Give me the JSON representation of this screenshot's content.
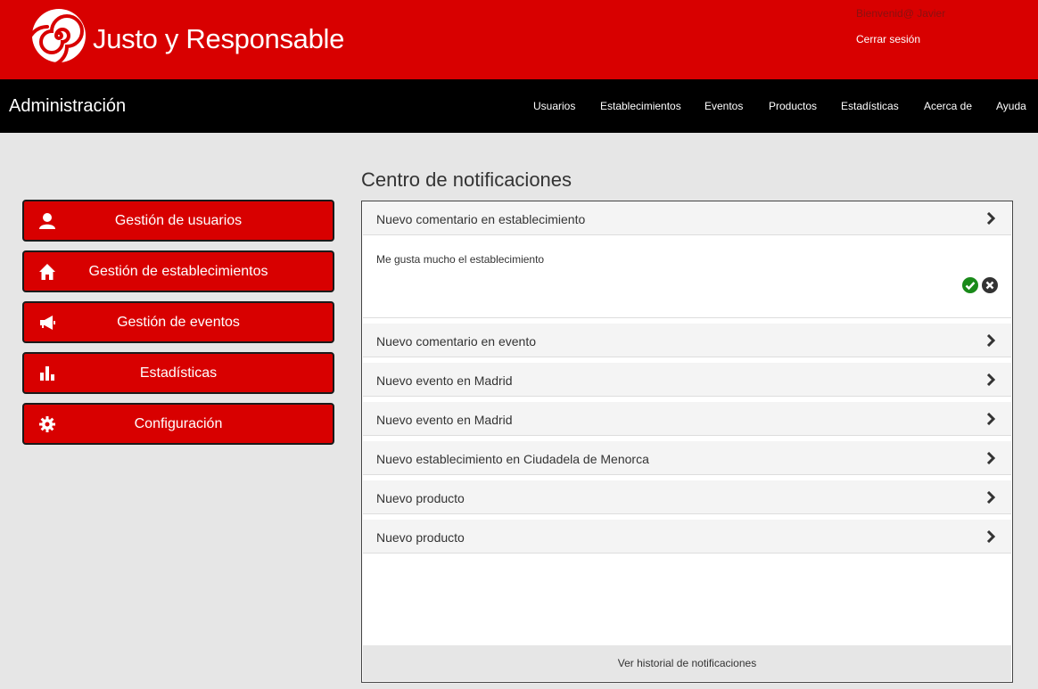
{
  "header": {
    "brand": "Justo y Responsable",
    "welcome": "Bienvenid@  Javier",
    "logout": "Cerrar sesión"
  },
  "navbar": {
    "title": "Administración",
    "items": [
      "Usuarios",
      "Establecimientos",
      "Eventos",
      "Productos",
      "Estadísticas",
      "Acerca de",
      "Ayuda"
    ]
  },
  "sidebar": {
    "items": [
      {
        "label": "Gestión de usuarios",
        "icon": "user-icon"
      },
      {
        "label": "Gestión de establecimientos",
        "icon": "home-icon"
      },
      {
        "label": "Gestión de eventos",
        "icon": "megaphone-icon"
      },
      {
        "label": "Estadísticas",
        "icon": "bar-chart-icon"
      },
      {
        "label": "Configuración",
        "icon": "gear-icon"
      }
    ]
  },
  "notifications": {
    "title": "Centro de notificaciones",
    "items": [
      {
        "title": "Nuevo comentario en establecimiento",
        "message": "Me gusta mucho el establecimiento",
        "expanded": true
      },
      {
        "title": "Nuevo comentario en evento"
      },
      {
        "title": "Nuevo evento en Madrid"
      },
      {
        "title": "Nuevo evento en Madrid"
      },
      {
        "title": "Nuevo establecimiento en Ciudadela de Menorca"
      },
      {
        "title": "Nuevo producto"
      },
      {
        "title": "Nuevo producto"
      }
    ],
    "history_link": "Ver historial de notificaciones"
  },
  "colors": {
    "brand_red": "#d80000",
    "navbar_bg": "#000000",
    "page_bg": "#e6e6e6",
    "approve_green": "#1a8a1a",
    "reject_dark": "#333333"
  }
}
